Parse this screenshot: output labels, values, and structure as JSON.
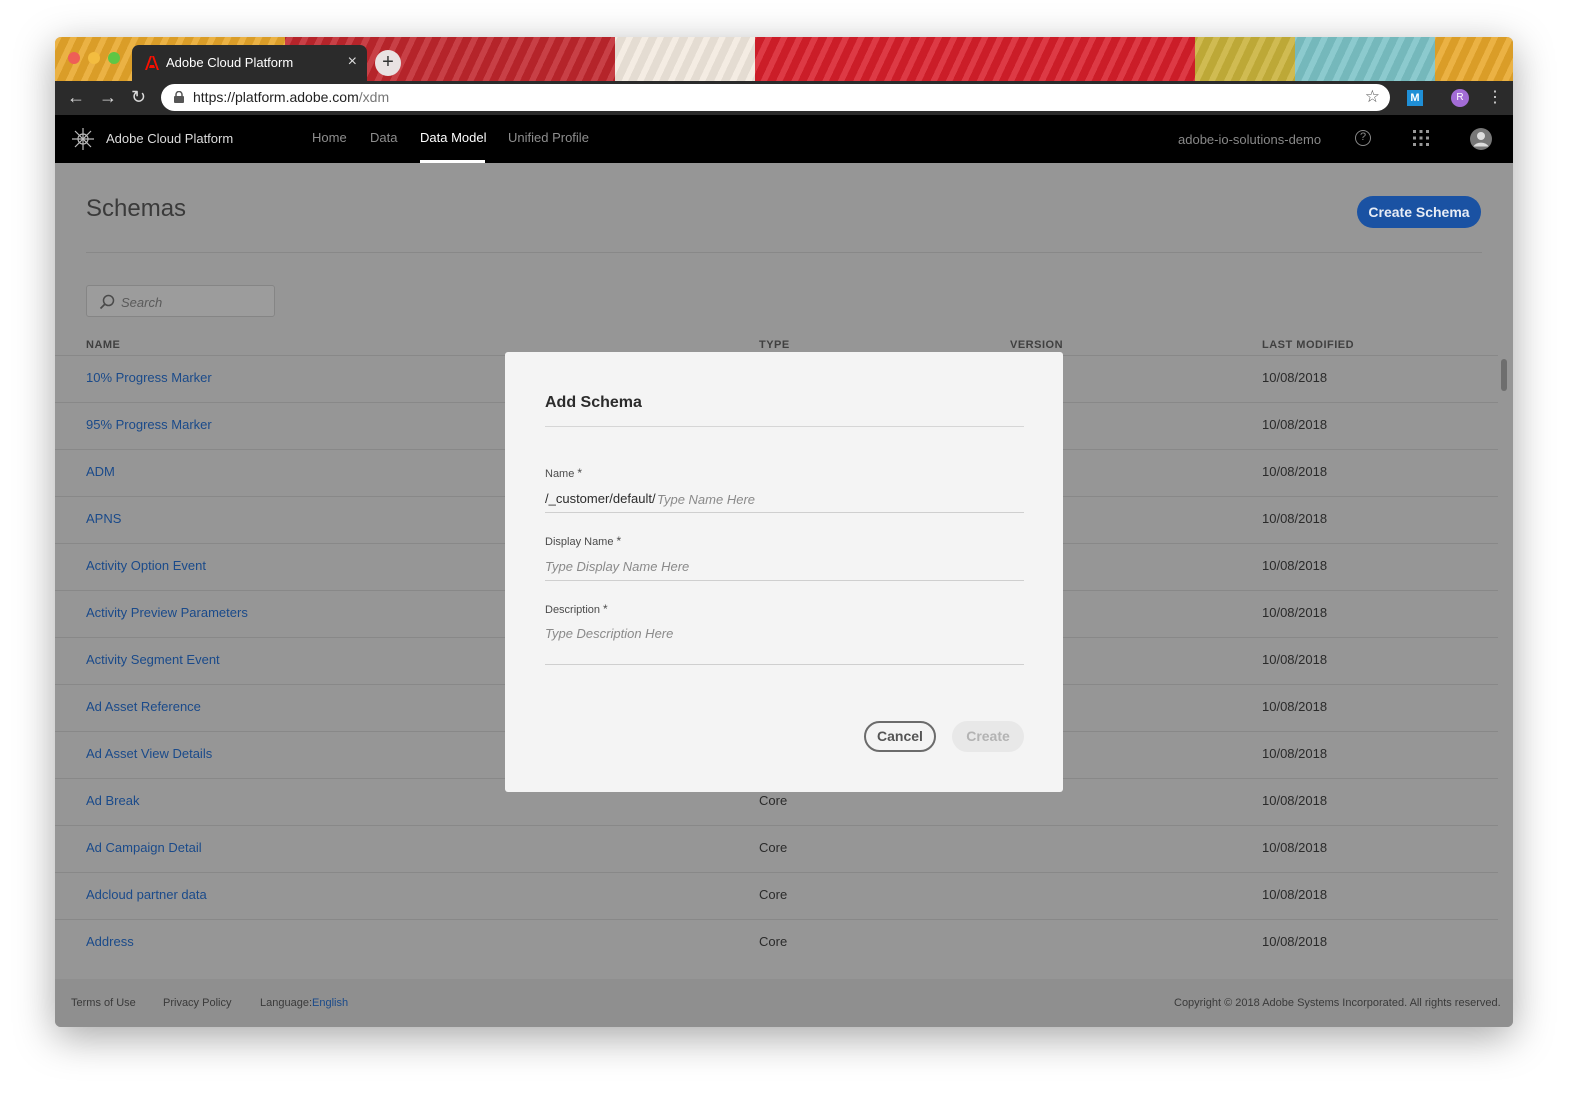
{
  "browser": {
    "tab_title": "Adobe Cloud Platform",
    "close_glyph": "×",
    "new_tab_glyph": "+",
    "url_host": "https://platform.adobe.com",
    "url_path": "/xdm",
    "back_glyph": "←",
    "forward_glyph": "→",
    "reload_glyph": "↻",
    "star_glyph": "☆",
    "ext_m_label": "M",
    "profile_initial": "R",
    "menu_glyph": "⋮"
  },
  "appbar": {
    "brand": "Adobe Cloud Platform",
    "nav": [
      "Home",
      "Data",
      "Data Model",
      "Unified Profile"
    ],
    "active_nav": "Data Model",
    "org": "adobe-io-solutions-demo",
    "help_glyph": "?"
  },
  "page": {
    "title": "Schemas",
    "create_button": "Create Schema",
    "search_placeholder": "Search",
    "columns": {
      "name": "NAME",
      "type": "TYPE",
      "version": "VERSION",
      "modified": "LAST MODIFIED"
    }
  },
  "rows": [
    {
      "name": "10% Progress Marker",
      "type": "",
      "modified": "10/08/2018"
    },
    {
      "name": "95% Progress Marker",
      "type": "",
      "modified": "10/08/2018"
    },
    {
      "name": "ADM",
      "type": "",
      "modified": "10/08/2018"
    },
    {
      "name": "APNS",
      "type": "",
      "modified": "10/08/2018"
    },
    {
      "name": "Activity Option Event",
      "type": "",
      "modified": "10/08/2018"
    },
    {
      "name": "Activity Preview Parameters",
      "type": "",
      "modified": "10/08/2018"
    },
    {
      "name": "Activity Segment Event",
      "type": "",
      "modified": "10/08/2018"
    },
    {
      "name": "Ad Asset Reference",
      "type": "",
      "modified": "10/08/2018"
    },
    {
      "name": "Ad Asset View Details",
      "type": "",
      "modified": "10/08/2018"
    },
    {
      "name": "Ad Break",
      "type": "Core",
      "modified": "10/08/2018"
    },
    {
      "name": "Ad Campaign Detail",
      "type": "Core",
      "modified": "10/08/2018"
    },
    {
      "name": "Adcloud partner data",
      "type": "Core",
      "modified": "10/08/2018"
    },
    {
      "name": "Address",
      "type": "Core",
      "modified": "10/08/2018"
    }
  ],
  "footer": {
    "terms": "Terms of Use",
    "privacy": "Privacy Policy",
    "language_label": "Language:",
    "language_value": "English",
    "copyright": "Copyright ©  2018 Adobe Systems Incorporated.  All rights reserved."
  },
  "modal": {
    "title": "Add Schema",
    "required_glyph": "*",
    "name_label": "Name",
    "name_prefix": "/_customer/default/",
    "name_placeholder": "Type Name Here",
    "display_name_label": "Display Name",
    "display_name_placeholder": "Type Display Name Here",
    "description_label": "Description",
    "description_placeholder": "Type Description Here",
    "cancel": "Cancel",
    "create": "Create"
  },
  "colors": {
    "primary_button": "#1a52a3",
    "link": "#1a4a8a",
    "appbar": "#000000"
  }
}
